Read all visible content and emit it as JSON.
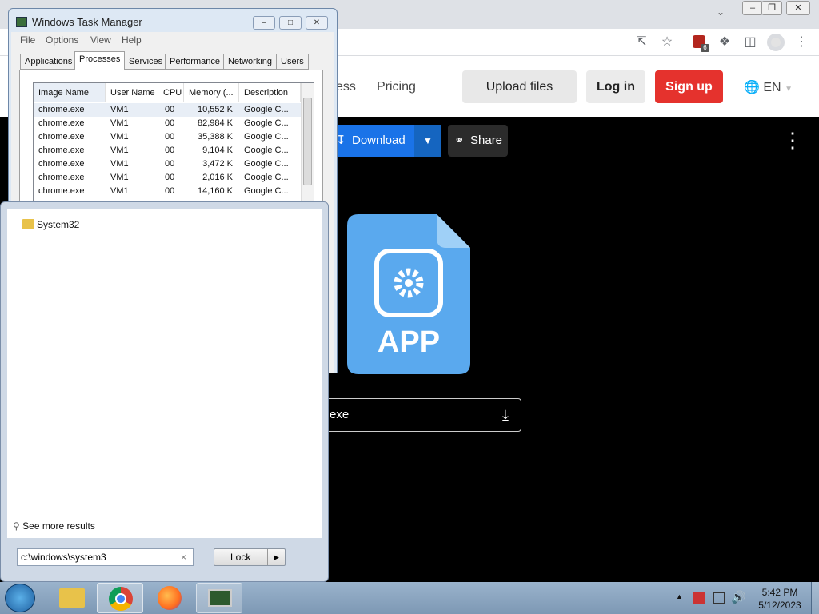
{
  "browser": {
    "site_nav": {
      "partial_link": "ess",
      "pricing": "Pricing",
      "upload": "Upload files",
      "login": "Log in",
      "signup": "Sign up",
      "lang": "EN"
    },
    "toolbar": {
      "download": "Download",
      "share": "Share"
    },
    "file": {
      "icon_label": "APP",
      "name_partial": "exe"
    },
    "extension_badge": "6"
  },
  "task_manager": {
    "title": "Windows Task Manager",
    "menu": [
      "File",
      "Options",
      "View",
      "Help"
    ],
    "tabs": [
      "Applications",
      "Processes",
      "Services",
      "Performance",
      "Networking",
      "Users"
    ],
    "active_tab": "Processes",
    "columns": [
      "Image Name",
      "User Name",
      "CPU",
      "Memory (...",
      "Description"
    ],
    "rows": [
      [
        "chrome.exe",
        "VM1",
        "00",
        "10,552 K",
        "Google C..."
      ],
      [
        "chrome.exe",
        "VM1",
        "00",
        "82,984 K",
        "Google C..."
      ],
      [
        "chrome.exe",
        "VM1",
        "00",
        "35,388 K",
        "Google C..."
      ],
      [
        "chrome.exe",
        "VM1",
        "00",
        "9,104 K",
        "Google C..."
      ],
      [
        "chrome.exe",
        "VM1",
        "00",
        "3,472 K",
        "Google C..."
      ],
      [
        "chrome.exe",
        "VM1",
        "00",
        "2,016 K",
        "Google C..."
      ],
      [
        "chrome.exe",
        "VM1",
        "00",
        "14,160 K",
        "Google C..."
      ]
    ]
  },
  "start_menu": {
    "result": "System32",
    "see_more": "See more results",
    "search_value": "c:\\windows\\system3",
    "clear": "×",
    "lock": "Lock"
  },
  "taskbar": {
    "time": "5:42 PM",
    "date": "5/12/2023"
  }
}
